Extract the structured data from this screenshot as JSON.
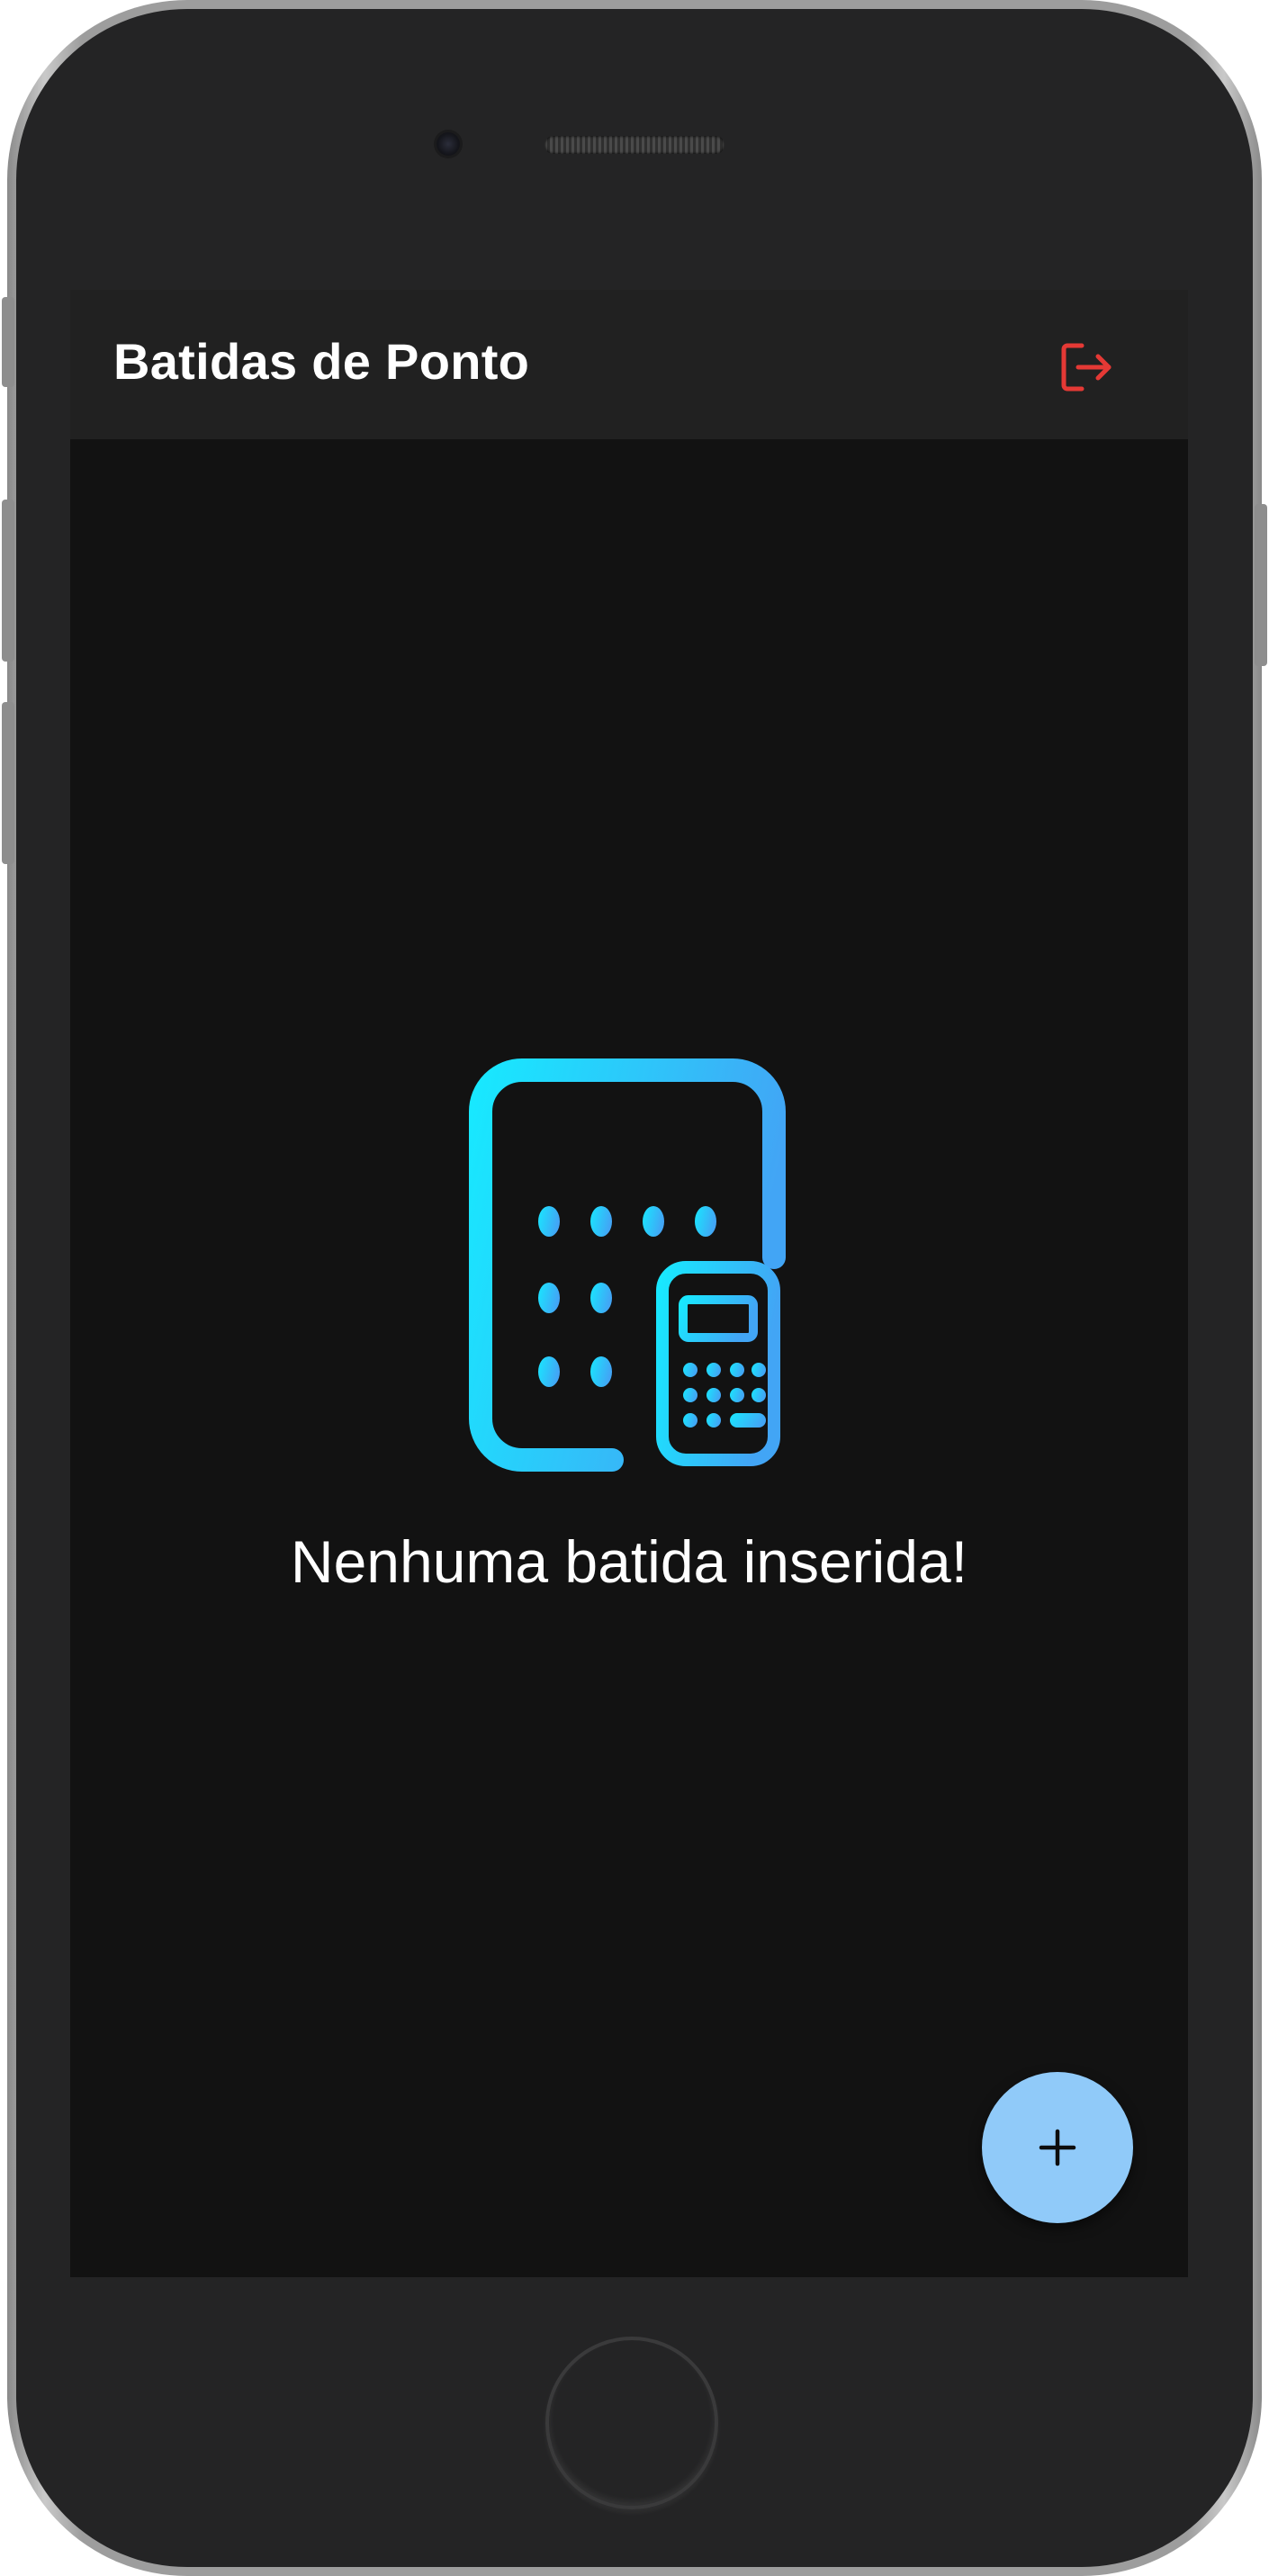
{
  "app_bar": {
    "title": "Batidas de Ponto",
    "logout_icon": "logout-icon"
  },
  "empty_state": {
    "icon": "calendar-calculator-icon",
    "message": "Nenhuma batida inserida!"
  },
  "fab": {
    "icon": "plus-icon"
  },
  "colors": {
    "screen_background": "#121212",
    "app_bar_background": "#212121",
    "logout_icon": "#e53935",
    "fab_background": "#90caf9",
    "illustration_gradient_start": "#18e8ff",
    "illustration_gradient_end": "#42a5f5"
  }
}
